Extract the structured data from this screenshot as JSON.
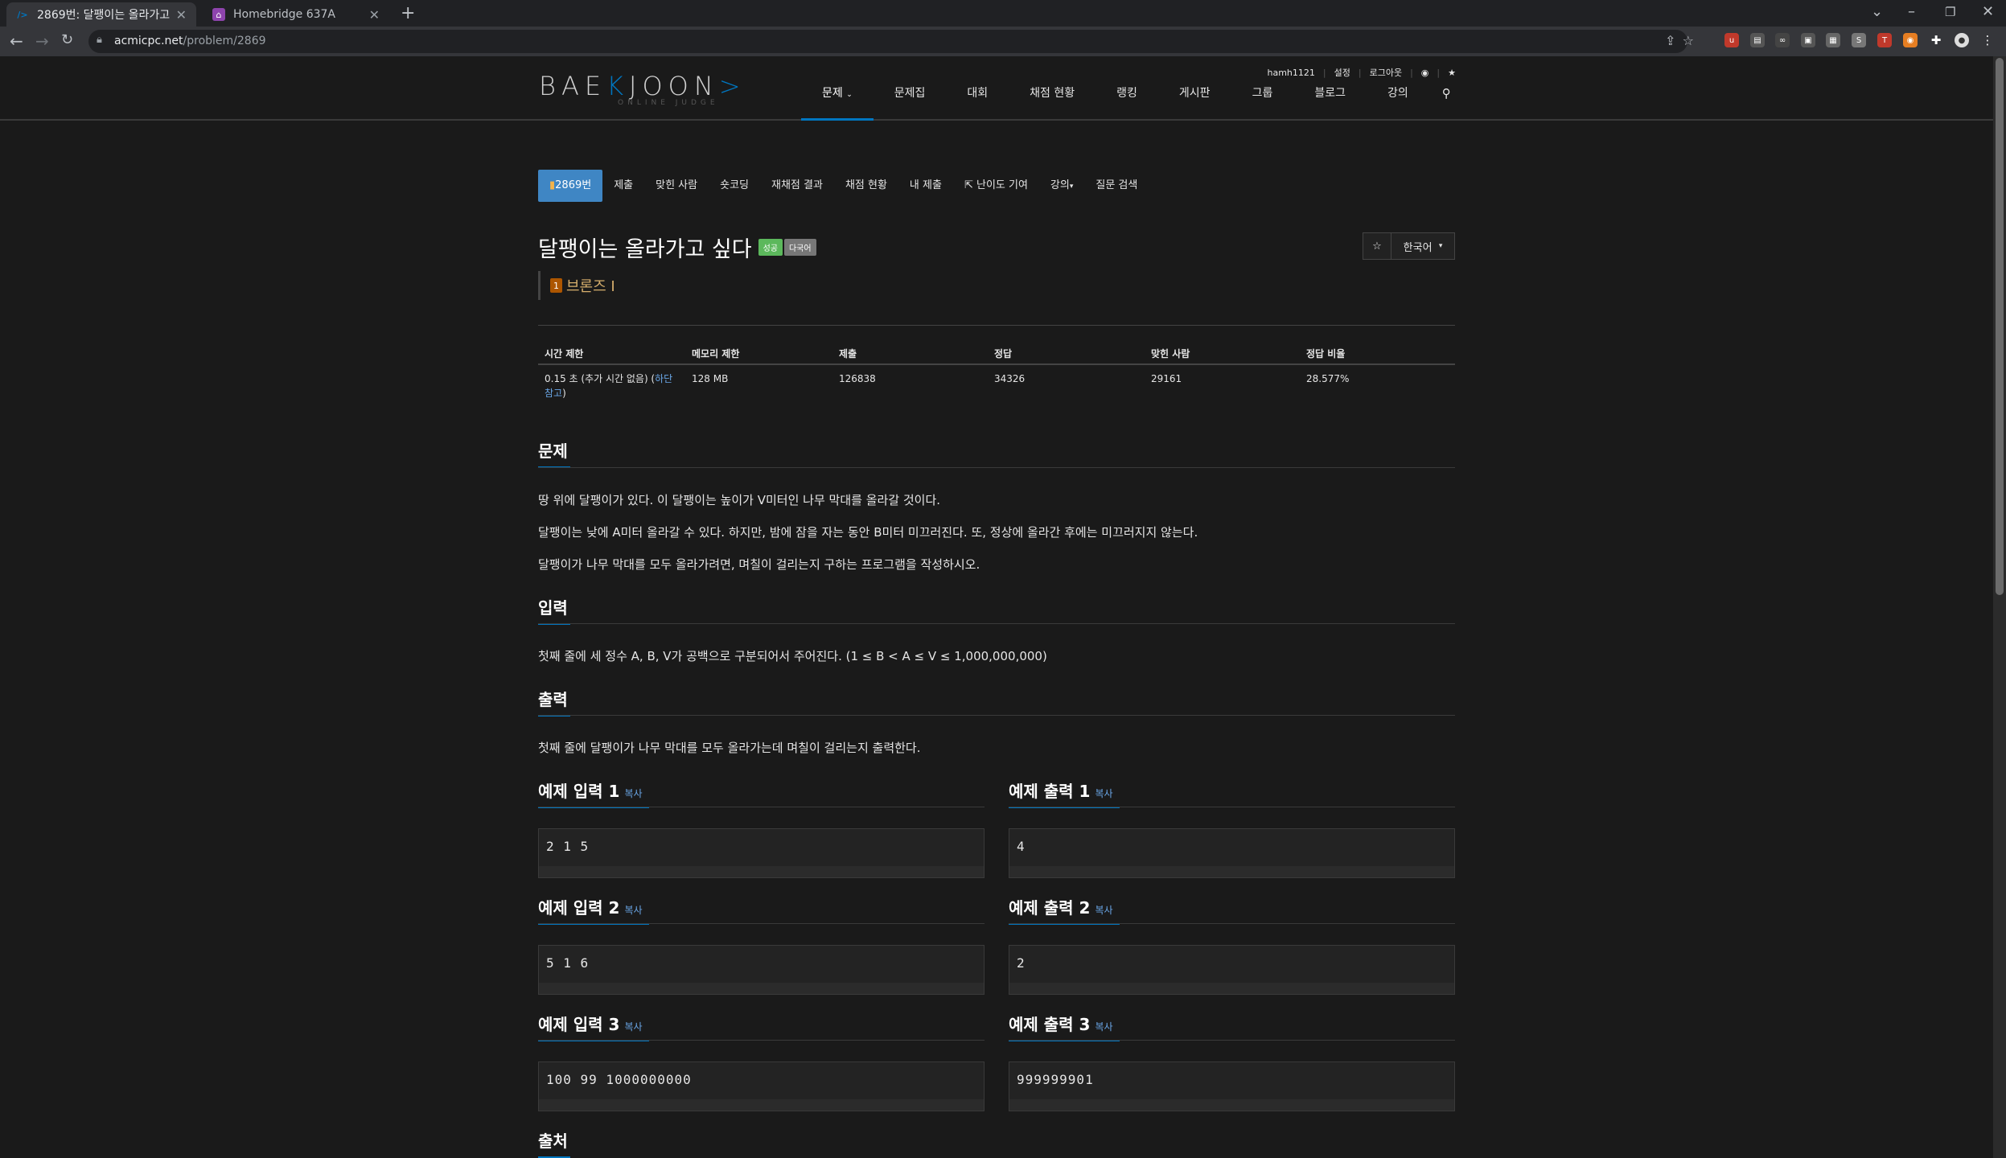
{
  "browser": {
    "tabs": [
      {
        "title": "2869번: 달팽이는 올라가고 싶다",
        "active": true
      },
      {
        "title": "Homebridge 637A",
        "active": false
      }
    ],
    "url_host": "acmicpc.net",
    "url_path": "/problem/2869"
  },
  "userbar": {
    "user": "hamh1121",
    "settings": "설정",
    "logout": "로그아웃"
  },
  "logo": {
    "text_before": "BAE",
    "text_accent": "K",
    "text_after": "JOON",
    "sub": "ONLINE JUDGE"
  },
  "mainnav": [
    "문제",
    "문제집",
    "대회",
    "채점 현황",
    "랭킹",
    "게시판",
    "그룹",
    "블로그",
    "강의"
  ],
  "subnav": {
    "problem_id": "2869번",
    "items": [
      "제출",
      "맞힌 사람",
      "숏코딩",
      "재채점 결과",
      "채점 현황",
      "내 제출",
      "난이도 기여",
      "강의",
      "질문 검색"
    ]
  },
  "problem": {
    "title": "달팽이는 올라가고 싶다",
    "badges": [
      "성공",
      "다국어"
    ],
    "tier": "브론즈 I",
    "language": "한국어"
  },
  "info_table": {
    "headers": [
      "시간 제한",
      "메모리 제한",
      "제출",
      "정답",
      "맞힌 사람",
      "정답 비율"
    ],
    "time_limit": "0.15 초 (추가 시간 없음) (",
    "time_link": "하단 참고",
    "time_close": ")",
    "memory": "128 MB",
    "submissions": "126838",
    "accepted": "34326",
    "solvers": "29161",
    "ratio": "28.577%"
  },
  "sections": {
    "problem_h": "문제",
    "problem_lines": [
      "땅 위에 달팽이가 있다. 이 달팽이는 높이가 V미터인 나무 막대를 올라갈 것이다.",
      "달팽이는 낮에 A미터 올라갈 수 있다. 하지만, 밤에 잠을 자는 동안 B미터 미끄러진다. 또, 정상에 올라간 후에는 미끄러지지 않는다.",
      "달팽이가 나무 막대를 모두 올라가려면, 며칠이 걸리는지 구하는 프로그램을 작성하시오."
    ],
    "input_h": "입력",
    "input_text": "첫째 줄에 세 정수 A, B, V가 공백으로 구분되어서 주어진다. (1 ≤ B < A ≤ V ≤ 1,000,000,000)",
    "output_h": "출력",
    "output_text": "첫째 줄에 달팽이가 나무 막대를 모두 올라가는데 며칠이 걸리는지 출력한다.",
    "copy": "복사",
    "samples": [
      {
        "in_h": "예제 입력 1",
        "in": "2 1 5",
        "out_h": "예제 출력 1",
        "out": "4"
      },
      {
        "in_h": "예제 입력 2",
        "in": "5 1 6",
        "out_h": "예제 출력 2",
        "out": "2"
      },
      {
        "in_h": "예제 입력 3",
        "in": "100 99 1000000000",
        "out_h": "예제 출력 3",
        "out": "999999901"
      }
    ],
    "source_h": "출처"
  }
}
